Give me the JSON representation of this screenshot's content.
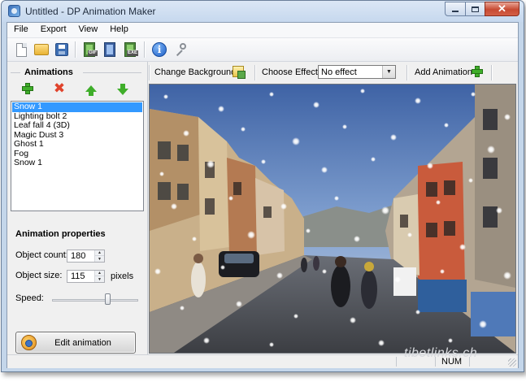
{
  "window": {
    "title": "Untitled - DP Animation Maker"
  },
  "menu": [
    "File",
    "Export",
    "View",
    "Help"
  ],
  "toolbar": {
    "buttons": [
      "new-icon",
      "open-folder-icon",
      "save-icon",
      "export-gif-icon",
      "export-video-icon",
      "export-exe-icon",
      "info-icon",
      "key-icon"
    ],
    "gif_tag": "GIF",
    "exe_tag": "EXE"
  },
  "animations_panel": {
    "heading": "Animations",
    "items": [
      "Snow 1",
      "Lighting bolt 2",
      "Leaf fall 4 (3D)",
      "Magic Dust 3",
      "Ghost 1",
      "Fog",
      "Snow 1"
    ],
    "selected_index": 0
  },
  "properties": {
    "heading": "Animation properties",
    "object_count_label": "Object count:",
    "object_count": "180",
    "object_size_label": "Object size:",
    "object_size": "115",
    "size_unit": "pixels",
    "speed_label": "Speed:",
    "speed_level": 0.66,
    "edit_button": "Edit animation"
  },
  "effect_bar": {
    "change_background": "Change Background",
    "choose_effect_label": "Choose Effect:",
    "effect_value": "No effect",
    "add_animation": "Add Animation"
  },
  "status_bar": {
    "num": "NUM"
  },
  "watermark": "tibetlinks.ch",
  "colors": {
    "selection": "#3399ff",
    "add_green": "#3fae2a",
    "delete_red": "#e0432c",
    "window_frame": "#c4d6ea"
  }
}
